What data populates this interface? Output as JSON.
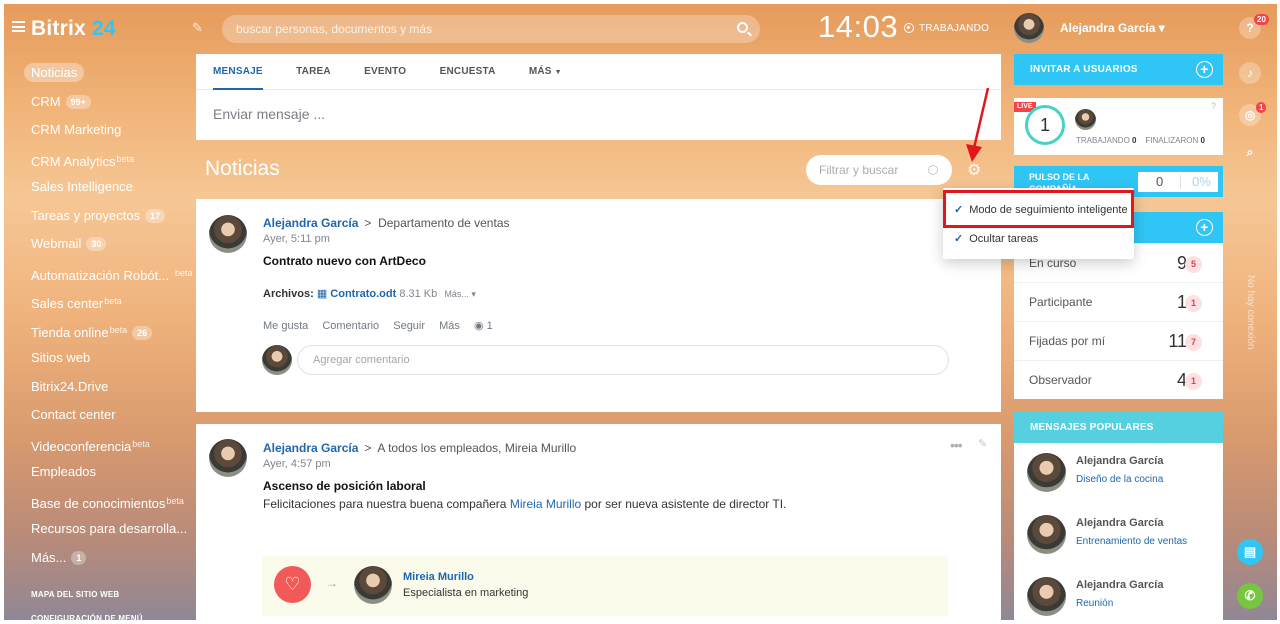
{
  "header": {
    "logo_text": "Bitrix",
    "logo_num": "24",
    "search_placeholder": "buscar personas, documentos y más",
    "clock": "14:03",
    "status": "TRABAJANDO",
    "user_name": "Alejandra García",
    "help_badge": "20",
    "notif_badge": "1"
  },
  "menu": {
    "items": [
      {
        "label": "Noticias",
        "count": "",
        "sup": ""
      },
      {
        "label": "CRM",
        "count": "99+",
        "sup": ""
      },
      {
        "label": "CRM Marketing",
        "count": "",
        "sup": ""
      },
      {
        "label": "CRM Analytics",
        "count": "",
        "sup": "beta"
      },
      {
        "label": "Sales Intelligence",
        "count": "",
        "sup": ""
      },
      {
        "label": "Tareas y proyectos",
        "count": "17",
        "sup": ""
      },
      {
        "label": "Webmail",
        "count": "30",
        "sup": ""
      },
      {
        "label": "Automatización Robót...",
        "count": "",
        "sup": "beta"
      },
      {
        "label": "Sales center",
        "count": "",
        "sup": "beta"
      },
      {
        "label": "Tienda online",
        "count": "26",
        "sup": "beta"
      },
      {
        "label": "Sitios web",
        "count": "",
        "sup": ""
      },
      {
        "label": "Bitrix24.Drive",
        "count": "",
        "sup": ""
      },
      {
        "label": "Contact center",
        "count": "",
        "sup": ""
      },
      {
        "label": "Videoconferencia",
        "count": "",
        "sup": "beta"
      },
      {
        "label": "Empleados",
        "count": "",
        "sup": ""
      },
      {
        "label": "Base de conocimientos",
        "count": "",
        "sup": "beta"
      },
      {
        "label": "Recursos para desarrolla...",
        "count": "",
        "sup": ""
      },
      {
        "label": "Más...",
        "count": "1",
        "sup": ""
      }
    ],
    "sitemap": "MAPA DEL SITIO WEB",
    "config": "CONFIGURACIÓN DE MENÚ"
  },
  "composer": {
    "tabs": [
      "MENSAJE",
      "TAREA",
      "EVENTO",
      "ENCUESTA",
      "MÁS"
    ],
    "placeholder": "Enviar mensaje ..."
  },
  "feed": {
    "title": "Noticias",
    "filter_placeholder": "Filtrar y buscar"
  },
  "dropdown": {
    "item1": "Modo de seguimiento inteligente",
    "item2": "Ocultar tareas"
  },
  "post1": {
    "author": "Alejandra García",
    "dest": "Departamento de ventas",
    "date": "Ayer, 5:11 pm",
    "title": "Contrato nuevo con ArtDeco",
    "files_label": "Archivos:",
    "file_name": "Contrato.odt",
    "file_size": "8.31 Kb",
    "more": "Más...",
    "actions": [
      "Me gusta",
      "Comentario",
      "Seguir",
      "Más"
    ],
    "views": "1",
    "comment_placeholder": "Agregar comentario"
  },
  "post2": {
    "author": "Alejandra García",
    "dest": "A todos los empleados, Mireia Murillo",
    "date": "Ayer, 4:57 pm",
    "title": "Ascenso de posición laboral",
    "text_a": "Felicitaciones para nuestra buena compañera ",
    "text_link": "Mireia Murillo",
    "text_b": "  por ser nueva asistente de director TI.",
    "grat_name": "Mireia Murillo",
    "grat_role": "Especialista en marketing"
  },
  "sidebar": {
    "invite": "INVITAR A USUARIOS",
    "live": "LIVE",
    "live_num": "1",
    "working_label": "TRABAJANDO",
    "working_val": "0",
    "finished_label": "FINALIZARON",
    "finished_val": "0",
    "pulse_label": "PULSO DE LA COMPAÑÍA",
    "pulse_val": "0",
    "pulse_pct": "0%",
    "tasks": [
      {
        "label": "En curso",
        "num": "9",
        "badge": "5"
      },
      {
        "label": "Participante",
        "num": "1",
        "badge": "1"
      },
      {
        "label": "Fijadas por mí",
        "num": "11",
        "badge": "7"
      },
      {
        "label": "Observador",
        "num": "4",
        "badge": "1"
      }
    ],
    "popular_title": "MENSAJES POPULARES",
    "popular": [
      {
        "name": "Alejandra García",
        "topic": "Diseño de la cocina"
      },
      {
        "name": "Alejandra García",
        "topic": "Entrenamiento de ventas"
      },
      {
        "name": "Alejandra García",
        "topic": "Reunión"
      }
    ],
    "vertical_text": "No hay conexión"
  },
  "colors": {
    "accent": "#2067b0",
    "teal": "#2fc6f6",
    "highlight": "#e3151d"
  }
}
